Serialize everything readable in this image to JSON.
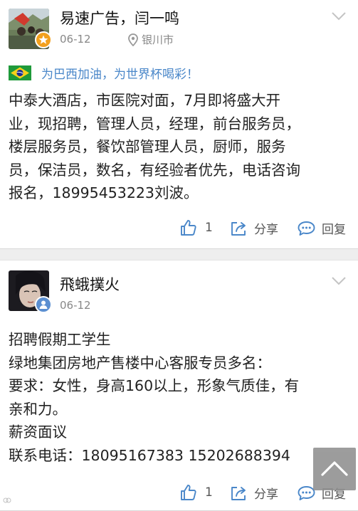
{
  "posts": [
    {
      "author": "易速广告，闫一鸣",
      "date": "06-12",
      "location": "银川市",
      "topic": "为巴西加油，为世界杯喝彩！",
      "body_lines": [
        "中泰大酒店，市医院对面，7月即将盛大开",
        "业，现招聘，管理人员，经理，前台服务员，",
        "楼层服务员，餐饮部管理人员，厨师，服务",
        "员，保洁员，数名，有经验者优先，电话咨询",
        "报名，18995453223刘波。"
      ],
      "like_count": "1",
      "share_label": "分享",
      "reply_label": "回复"
    },
    {
      "author": "飛蛾撲火",
      "date": "06-12",
      "body_lines": [
        "招聘假期工学生",
        "绿地集团房地产售楼中心客服专员多名：",
        "要求：女性，身高160以上，形象气质佳，有",
        "亲和力。",
        "薪资面议",
        "联系电话：18095167383 15202688394"
      ],
      "like_count": "1",
      "share_label": "分享",
      "reply_label": "回复"
    }
  ],
  "colors": {
    "accent": "#4a87c9",
    "badge_vip": "#f2a01d",
    "badge_user": "#5b8fd1"
  },
  "icons": [
    "location-pin-icon",
    "brazil-flag-icon",
    "thumbs-up-icon",
    "share-icon",
    "comment-icon",
    "chevron-down-icon",
    "arrow-up-icon"
  ]
}
